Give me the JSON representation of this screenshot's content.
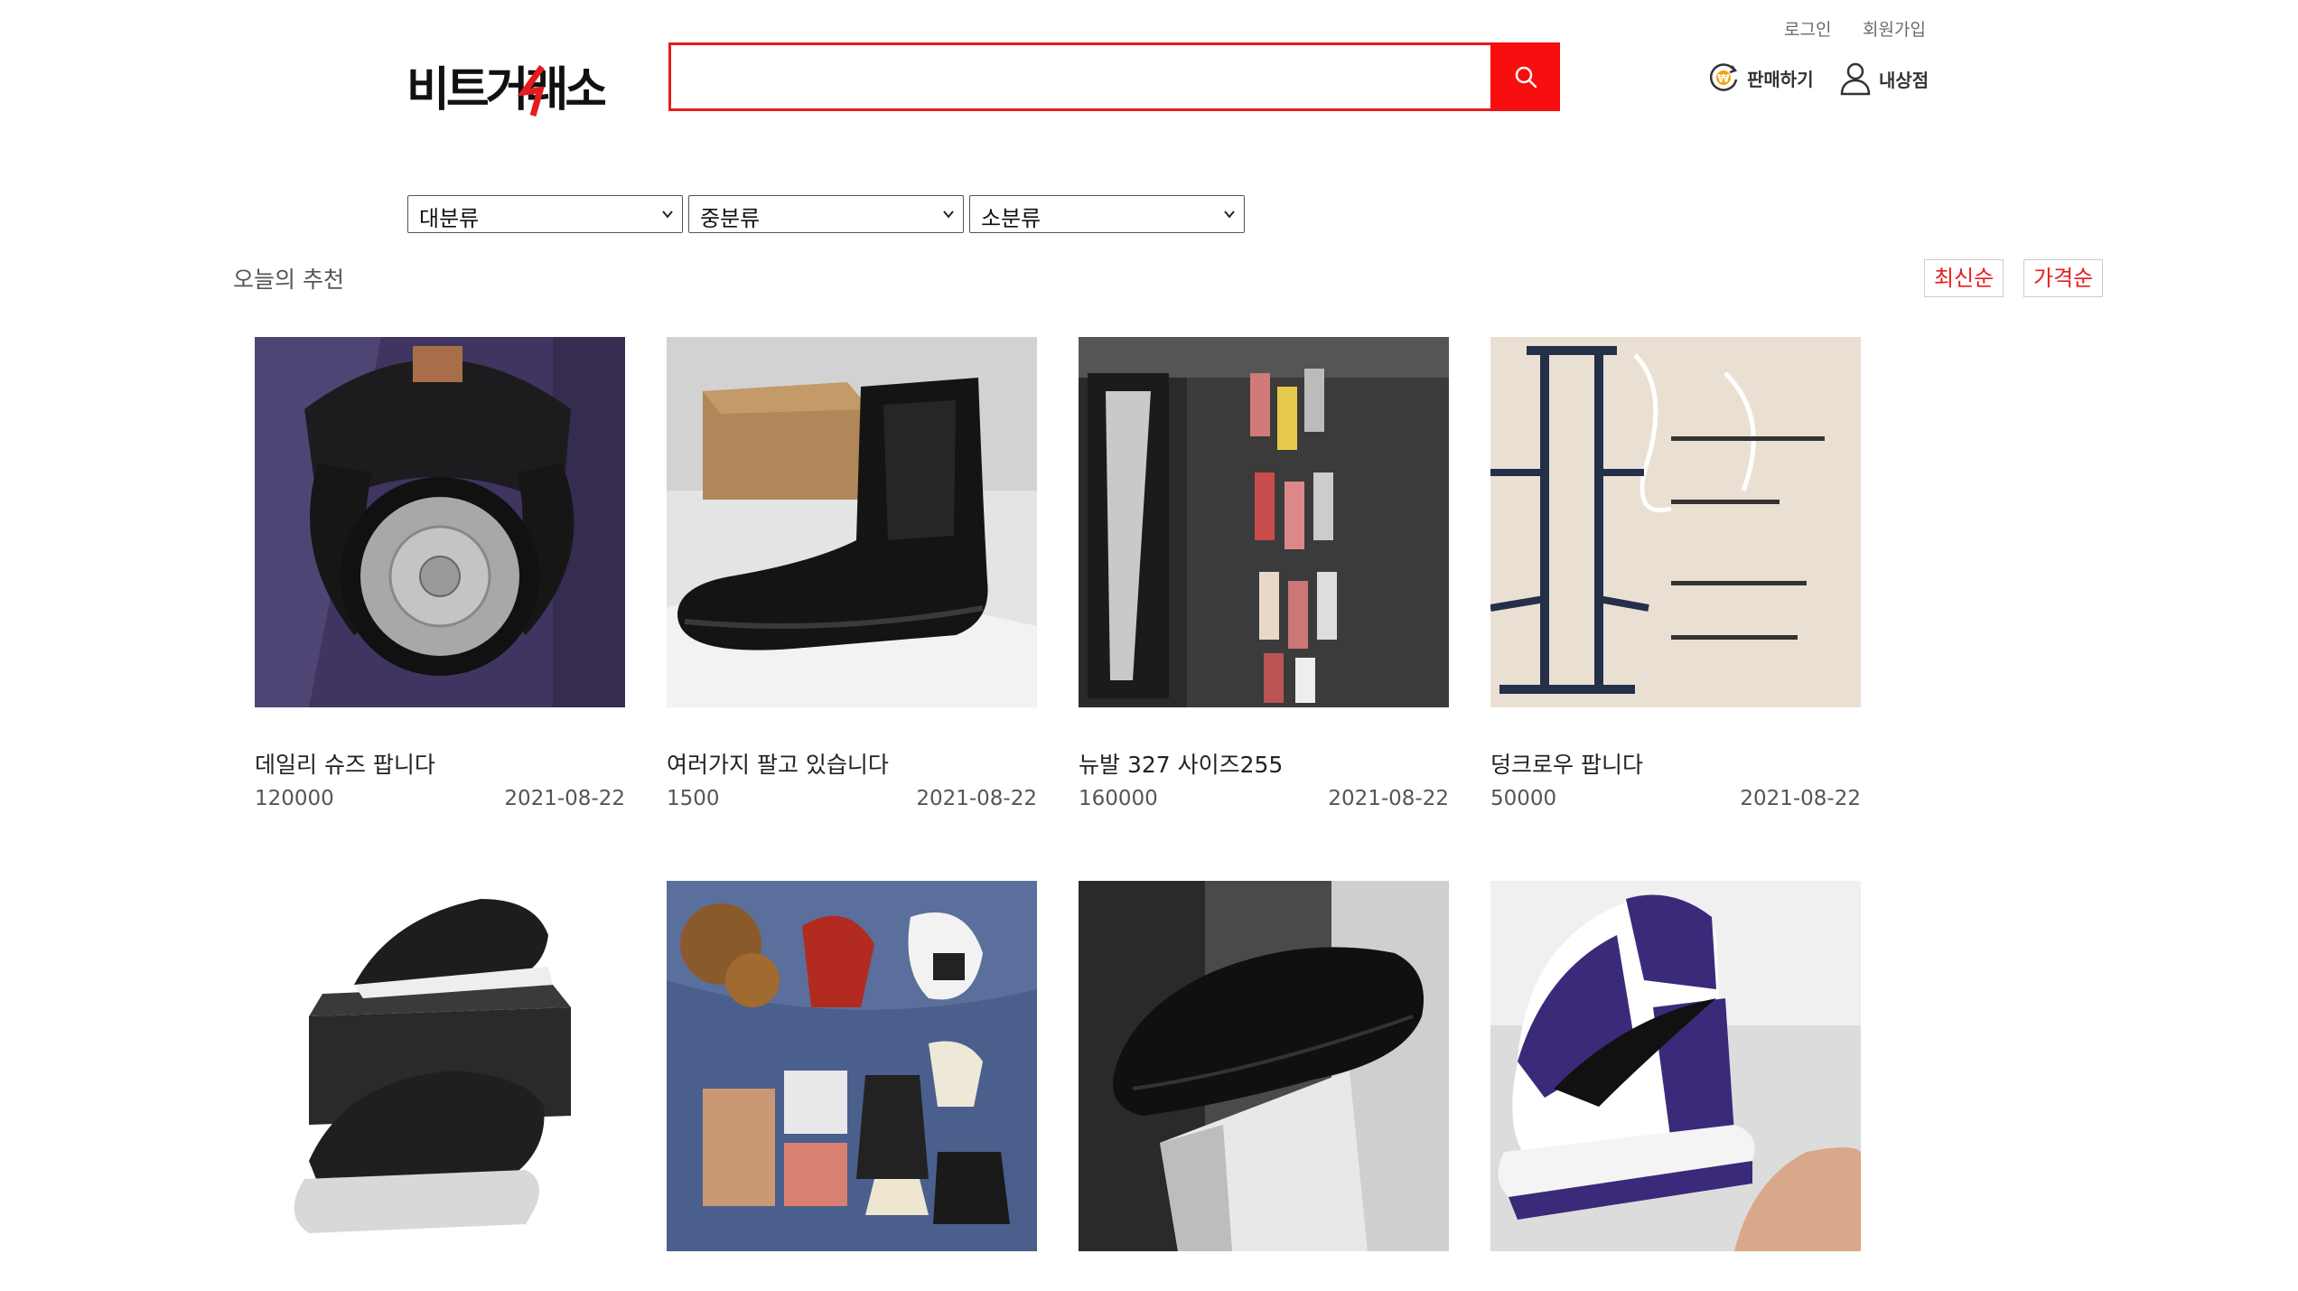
{
  "header": {
    "logo_text": "비트거래소",
    "top_links": {
      "login": "로그인",
      "signup": "회원가입"
    },
    "search": {
      "placeholder": "",
      "value": ""
    },
    "actions": {
      "sell": "판매하기",
      "my_store": "내상점"
    }
  },
  "categories": {
    "large": "대분류",
    "medium": "중분류",
    "small": "소분류"
  },
  "section_title": "오늘의 추천",
  "sort": {
    "latest": "최신순",
    "price": "가격순"
  },
  "products": [
    {
      "title": "데일리 슈즈 팝니다",
      "price": "120000",
      "date": "2021-08-22",
      "image": "watch-photo"
    },
    {
      "title": "여러가지 팔고 있습니다",
      "price": "1500",
      "date": "2021-08-22",
      "image": "chelsea-boot-photo"
    },
    {
      "title": "뉴발 327 사이즈255",
      "price": "160000",
      "date": "2021-08-22",
      "image": "album-photo"
    },
    {
      "title": "덩크로우 팝니다",
      "price": "50000",
      "date": "2021-08-22",
      "image": "pullup-bar-photo"
    },
    {
      "title": "",
      "price": "",
      "date": "",
      "image": "sneaker-box-photo"
    },
    {
      "title": "",
      "price": "",
      "date": "",
      "image": "doll-clothes-photo"
    },
    {
      "title": "",
      "price": "",
      "date": "",
      "image": "dress-shoe-photo"
    },
    {
      "title": "",
      "price": "",
      "date": "",
      "image": "jordan-sneaker-photo"
    }
  ],
  "colors": {
    "accent": "#e51d1d",
    "search_button": "#f80e0e",
    "coin_icon": "#f4a20c"
  }
}
